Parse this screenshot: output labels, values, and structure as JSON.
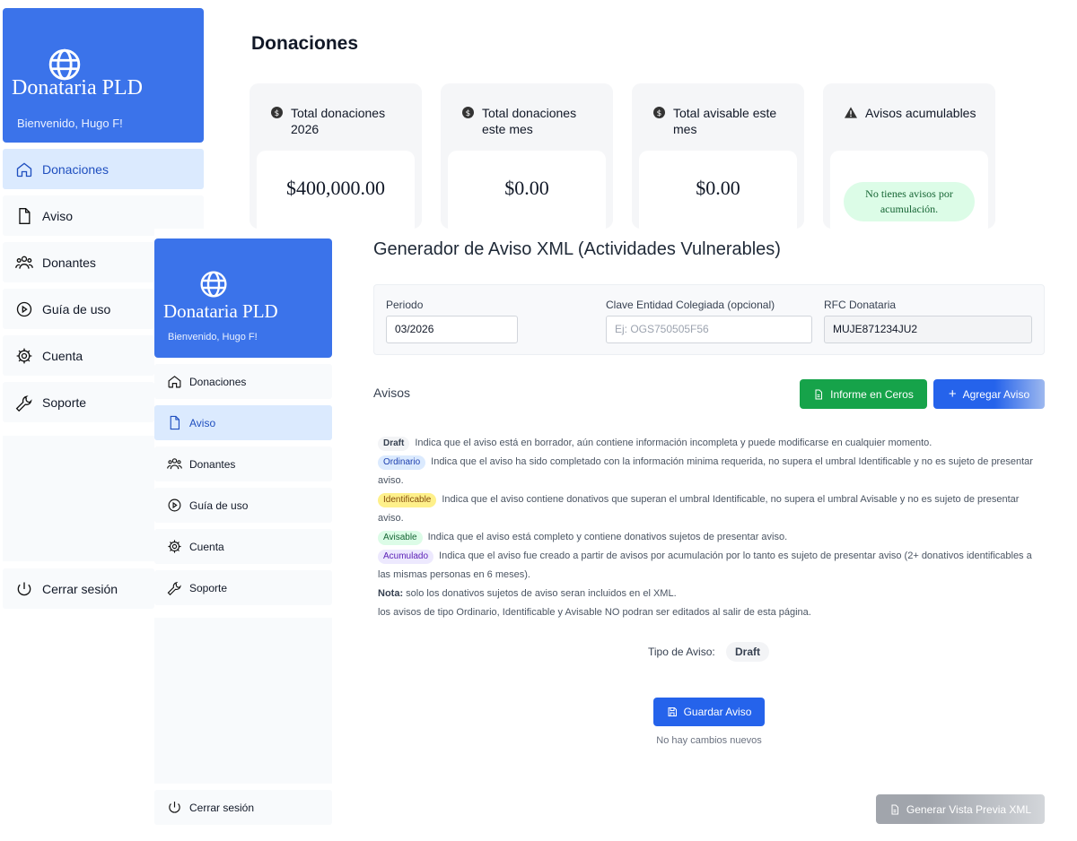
{
  "back": {
    "brand": {
      "name": "Donataria PLD",
      "welcome": "Bienvenido, Hugo F!"
    },
    "sidebar_items": [
      {
        "label": "Donaciones",
        "icon": "home-icon",
        "active": true
      },
      {
        "label": "Aviso",
        "icon": "document-icon",
        "active": false
      },
      {
        "label": "Donantes",
        "icon": "users-icon",
        "active": false
      },
      {
        "label": "Guía de uso",
        "icon": "play-circle-icon",
        "active": false
      },
      {
        "label": "Cuenta",
        "icon": "gear-icon",
        "active": false
      },
      {
        "label": "Soporte",
        "icon": "wrench-icon",
        "active": false
      }
    ],
    "logout_label": "Cerrar sesión",
    "page_title": "Donaciones",
    "stats": [
      {
        "label": "Total donaciones 2026",
        "value": "$400,000.00",
        "icon": "dollar-circle-icon"
      },
      {
        "label": "Total donaciones este mes",
        "value": "$0.00",
        "icon": "dollar-circle-icon"
      },
      {
        "label": "Total avisable este mes",
        "value": "$0.00",
        "icon": "dollar-circle-icon"
      },
      {
        "label": "Avisos acumulables",
        "value": "No tienes avisos por acumulación.",
        "icon": "warning-icon"
      }
    ]
  },
  "front": {
    "brand": {
      "name": "Donataria PLD",
      "welcome": "Bienvenido, Hugo F!"
    },
    "sidebar_items": [
      {
        "label": "Donaciones",
        "icon": "home-icon",
        "active": false
      },
      {
        "label": "Aviso",
        "icon": "document-icon",
        "active": true
      },
      {
        "label": "Donantes",
        "icon": "users-icon",
        "active": false
      },
      {
        "label": "Guía de uso",
        "icon": "play-circle-icon",
        "active": false
      },
      {
        "label": "Cuenta",
        "icon": "gear-icon",
        "active": false
      },
      {
        "label": "Soporte",
        "icon": "wrench-icon",
        "active": false
      }
    ],
    "logout_label": "Cerrar sesión",
    "title": "Generador de Aviso XML (Actividades Vulnerables)",
    "fields": {
      "periodo": {
        "label": "Periodo",
        "value": "03/2026"
      },
      "clave": {
        "label": "Clave Entidad Colegiada (opcional)",
        "placeholder": "Ej: OGS750505F56",
        "value": ""
      },
      "rfc": {
        "label": "RFC Donataria",
        "value": "MUJE871234JU2"
      }
    },
    "avisos_heading": "Avisos",
    "buttons": {
      "informe": "Informe en Ceros",
      "agregar": "Agregar Aviso",
      "guardar": "Guardar Aviso",
      "preview": "Generar Vista Previa XML"
    },
    "legend": [
      {
        "badge": "Draft",
        "text": "Indica que el aviso está en borrador, aún contiene información incompleta y puede modificarse en cualquier momento."
      },
      {
        "badge": "Ordinario",
        "text": "Indica que el aviso ha sido completado con la información minima requerida, no supera el umbral Identificable y no es sujeto de presentar aviso."
      },
      {
        "badge": "Identificable",
        "text": "Indica que el aviso contiene donativos que superan el umbral Identificable, no supera el umbral Avisable y no es sujeto de presentar aviso."
      },
      {
        "badge": "Avisable",
        "text": "Indica que el aviso está completo y contiene donativos sujetos de presentar aviso."
      },
      {
        "badge": "Acumulado",
        "text": "Indica que el aviso fue creado a partir de avisos por acumulación por lo tanto es sujeto de presentar aviso (2+ donativos identificables a las mismas personas en 6 meses)."
      }
    ],
    "note_bold": "Nota:",
    "note_text": "solo los donativos sujetos de aviso seran incluidos en el XML.",
    "note_line2": "los avisos de tipo Ordinario, Identificable y Avisable NO podran ser editados al salir de esta página.",
    "tipo_label": "Tipo de Aviso:",
    "tipo_value": "Draft",
    "no_changes": "No hay cambios nuevos"
  },
  "colors": {
    "brand_blue": "#3b73ea",
    "primary_blue": "#2563eb",
    "success_green": "#16a34a",
    "active_nav_bg": "#dbeafe"
  }
}
